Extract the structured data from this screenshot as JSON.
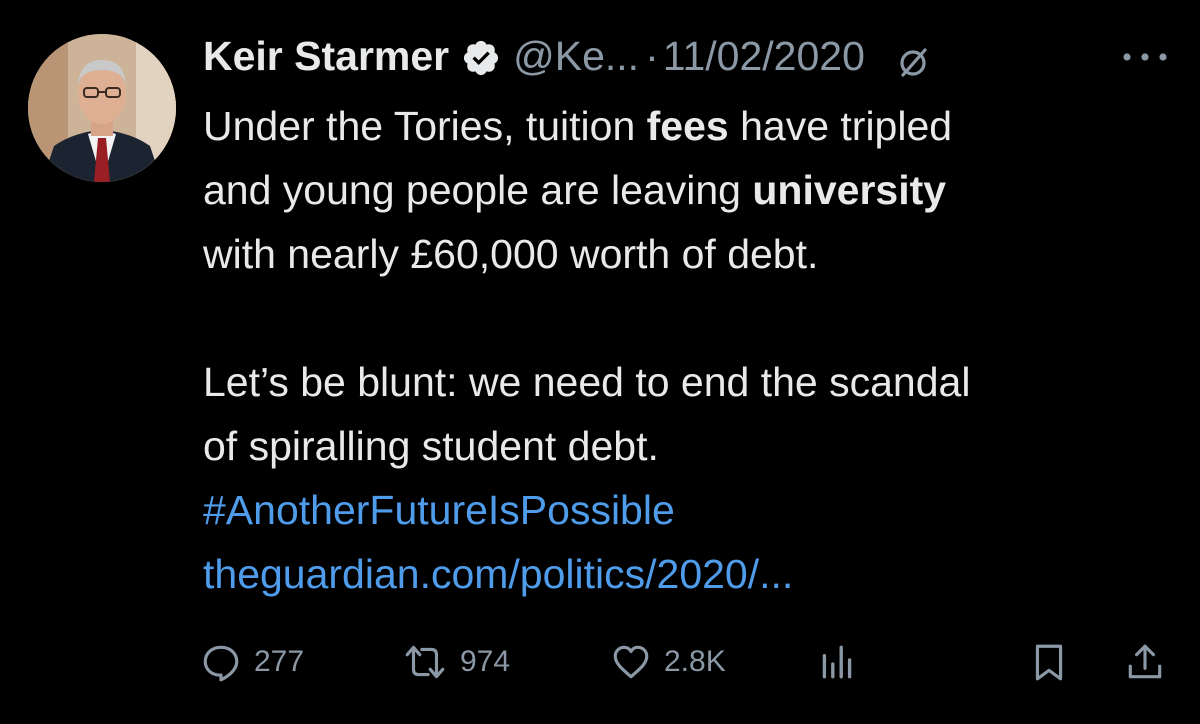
{
  "tweet": {
    "author": {
      "name": "Keir Starmer",
      "handle": "@Ke...",
      "verified": true,
      "avatar_icon": "avatar-photo"
    },
    "separator": "·",
    "timestamp": "11/02/2020",
    "body": {
      "line1_a": "Under the Tories, tuition ",
      "line1_b": "fees",
      "line1_c": " have tripled",
      "line2_a": "and young people are leaving ",
      "line2_b": "university",
      "line3": "with nearly £60,000 worth of debt.",
      "para2_line1": "Let’s be blunt: we need to end the scandal",
      "para2_line2": "of spiralling student debt.",
      "hashtag": "#AnotherFutureIsPossible",
      "link": "theguardian.com/politics/2020/..."
    },
    "stats": {
      "replies": "277",
      "retweets": "974",
      "likes": "2.8K"
    },
    "icons": {
      "verified": "verified-badge-icon",
      "edited": "edited-slash-icon",
      "more": "more-icon",
      "reply": "reply-icon",
      "retweet": "retweet-icon",
      "like": "heart-icon",
      "views": "views-chart-icon",
      "bookmark": "bookmark-icon",
      "share": "share-icon"
    },
    "colors": {
      "background": "#000000",
      "text": "#e7e9ea",
      "muted": "#8b98a5",
      "link": "#4f9ceb",
      "verified_badge": "#e7e9ea"
    }
  }
}
